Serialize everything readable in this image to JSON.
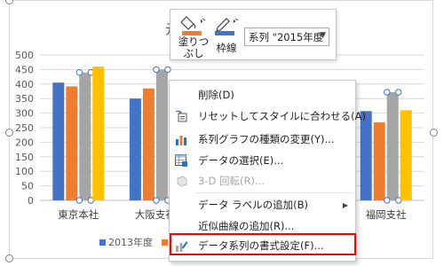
{
  "chart_data": {
    "type": "bar",
    "title": "",
    "categories": [
      "東京本社",
      "大阪支社",
      "",
      "",
      "福岡支社"
    ],
    "series": [
      {
        "name": "2013年度",
        "color": "#4472c4",
        "values": [
          405,
          350,
          null,
          null,
          307
        ]
      },
      {
        "name": "",
        "color": "#ed7d31",
        "values": [
          392,
          385,
          null,
          null,
          268
        ]
      },
      {
        "name": "2015年度",
        "color": "#a5a5a5",
        "values": [
          440,
          450,
          null,
          null,
          372
        ]
      },
      {
        "name": "",
        "color": "#ffc000",
        "values": [
          460,
          null,
          null,
          null,
          310
        ]
      }
    ],
    "yticks": [
      "0",
      "50",
      "100",
      "150",
      "200",
      "250",
      "300",
      "350",
      "400",
      "450",
      "500"
    ],
    "ylim": [
      0,
      500
    ],
    "grid": true,
    "legend": "bottom"
  },
  "toolbar": {
    "fill_label_line1": "塗りつ",
    "fill_label_line2": "ぶし",
    "outline_label": "枠線",
    "series_select_value": "系列 \"2015年度",
    "fill_icon": "paint-bucket-icon",
    "outline_icon": "pen-icon",
    "fill_color": "#ed7d31",
    "outline_color": "#4472c4"
  },
  "context_menu": {
    "items": [
      {
        "label": "削除(D)",
        "icon": "",
        "enabled": true
      },
      {
        "label": "リセットしてスタイルに合わせる(A)",
        "icon": "reset-style-icon",
        "enabled": true
      },
      {
        "label": "系列グラフの種類の変更(Y)...",
        "icon": "change-chart-type-icon",
        "enabled": true
      },
      {
        "label": "データの選択(E)...",
        "icon": "select-data-icon",
        "enabled": true
      },
      {
        "label": "3-D 回転(R)...",
        "icon": "3d-rotation-icon",
        "enabled": false
      },
      {
        "label": "データ ラベルの追加(B)",
        "icon": "",
        "enabled": true,
        "submenu": true
      },
      {
        "label": "近似曲線の追加(R)...",
        "icon": "",
        "enabled": true
      },
      {
        "label": "データ系列の書式設定(F)...",
        "icon": "format-data-series-icon",
        "enabled": true,
        "highlighted": true
      }
    ],
    "highlight_color": "#ff0000"
  },
  "title_fragment": "元"
}
